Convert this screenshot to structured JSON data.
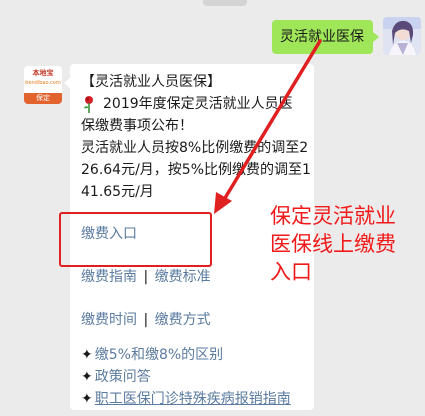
{
  "outgoing": {
    "text": "灵活就业医保"
  },
  "incoming": {
    "avatar": {
      "brand": "本地宝",
      "sub": "bendibao.com",
      "city": "保定"
    },
    "title": "【灵活就业人员医保】",
    "notice_line1": "2019年度保定灵活就业人员医",
    "notice_line2": "保缴费事项公布！",
    "body_lines": [
      "灵活就业人员按8%比例缴费的调至2",
      "26.64元/月，按5%比例缴费的调至1",
      "41.65元/月"
    ],
    "entry_link": "缴费入口",
    "links_row1": [
      "缴费指南",
      "缴费标准"
    ],
    "links_row2": [
      "缴费时间",
      "缴费方式"
    ],
    "separator": "|",
    "bullets": [
      "缴5%和缴8%的区别",
      "政策问答",
      "职工医保门诊特殊疾病报销指南"
    ]
  },
  "annotation": {
    "text_lines": [
      "保定灵活就业",
      "医保线上缴费",
      "入口"
    ]
  },
  "colors": {
    "background": "#ebebeb",
    "outgoing_bubble": "#9fe658",
    "link": "#5b7ba0",
    "annotation": "#f01a1a"
  }
}
